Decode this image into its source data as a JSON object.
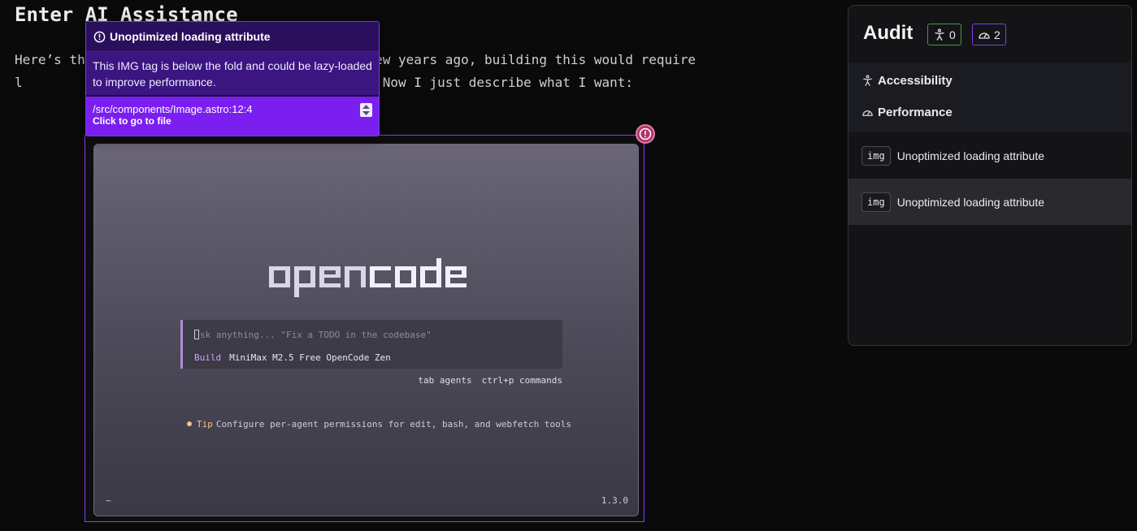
{
  "article": {
    "heading": "Enter AI Assistance",
    "paragraph": "Here’s th                                  A few years ago, building this would require l                                nt pipelines. Now I just describe what I want:"
  },
  "tooltip": {
    "title": "Unoptimized loading attribute",
    "message": "This IMG tag is below the fold and could be lazy-loaded to improve performance.",
    "file_path": "/src/components/Image.astro:12:4",
    "file_hint": "Click to go to file"
  },
  "screenshot": {
    "logo_text": "opencode",
    "prompt_placeholder": "sk anything... \"Fix a TODO in the codebase\"",
    "mode": "Build",
    "model": "MiniMax M2.5 Free OpenCode Zen",
    "shortcut_1": "tab agents",
    "shortcut_2": "ctrl+p commands",
    "tip_label": "Tip",
    "tip_text": "Configure per-agent permissions for edit, bash, and webfetch tools",
    "footer_left": "~",
    "footer_right": "1.3.0"
  },
  "audit": {
    "title": "Audit",
    "a11y_count": "0",
    "perf_count": "2",
    "categories": [
      {
        "label": "Accessibility",
        "icon": "accessibility-icon"
      },
      {
        "label": "Performance",
        "icon": "gauge-icon"
      }
    ],
    "issues": [
      {
        "tag": "img",
        "label": "Unoptimized loading attribute"
      },
      {
        "tag": "img",
        "label": "Unoptimized loading attribute"
      }
    ]
  },
  "colors": {
    "accent_purple": "#7a1ff0",
    "badge_pink": "#b0346e",
    "a11y_green": "#3f9a4a"
  }
}
